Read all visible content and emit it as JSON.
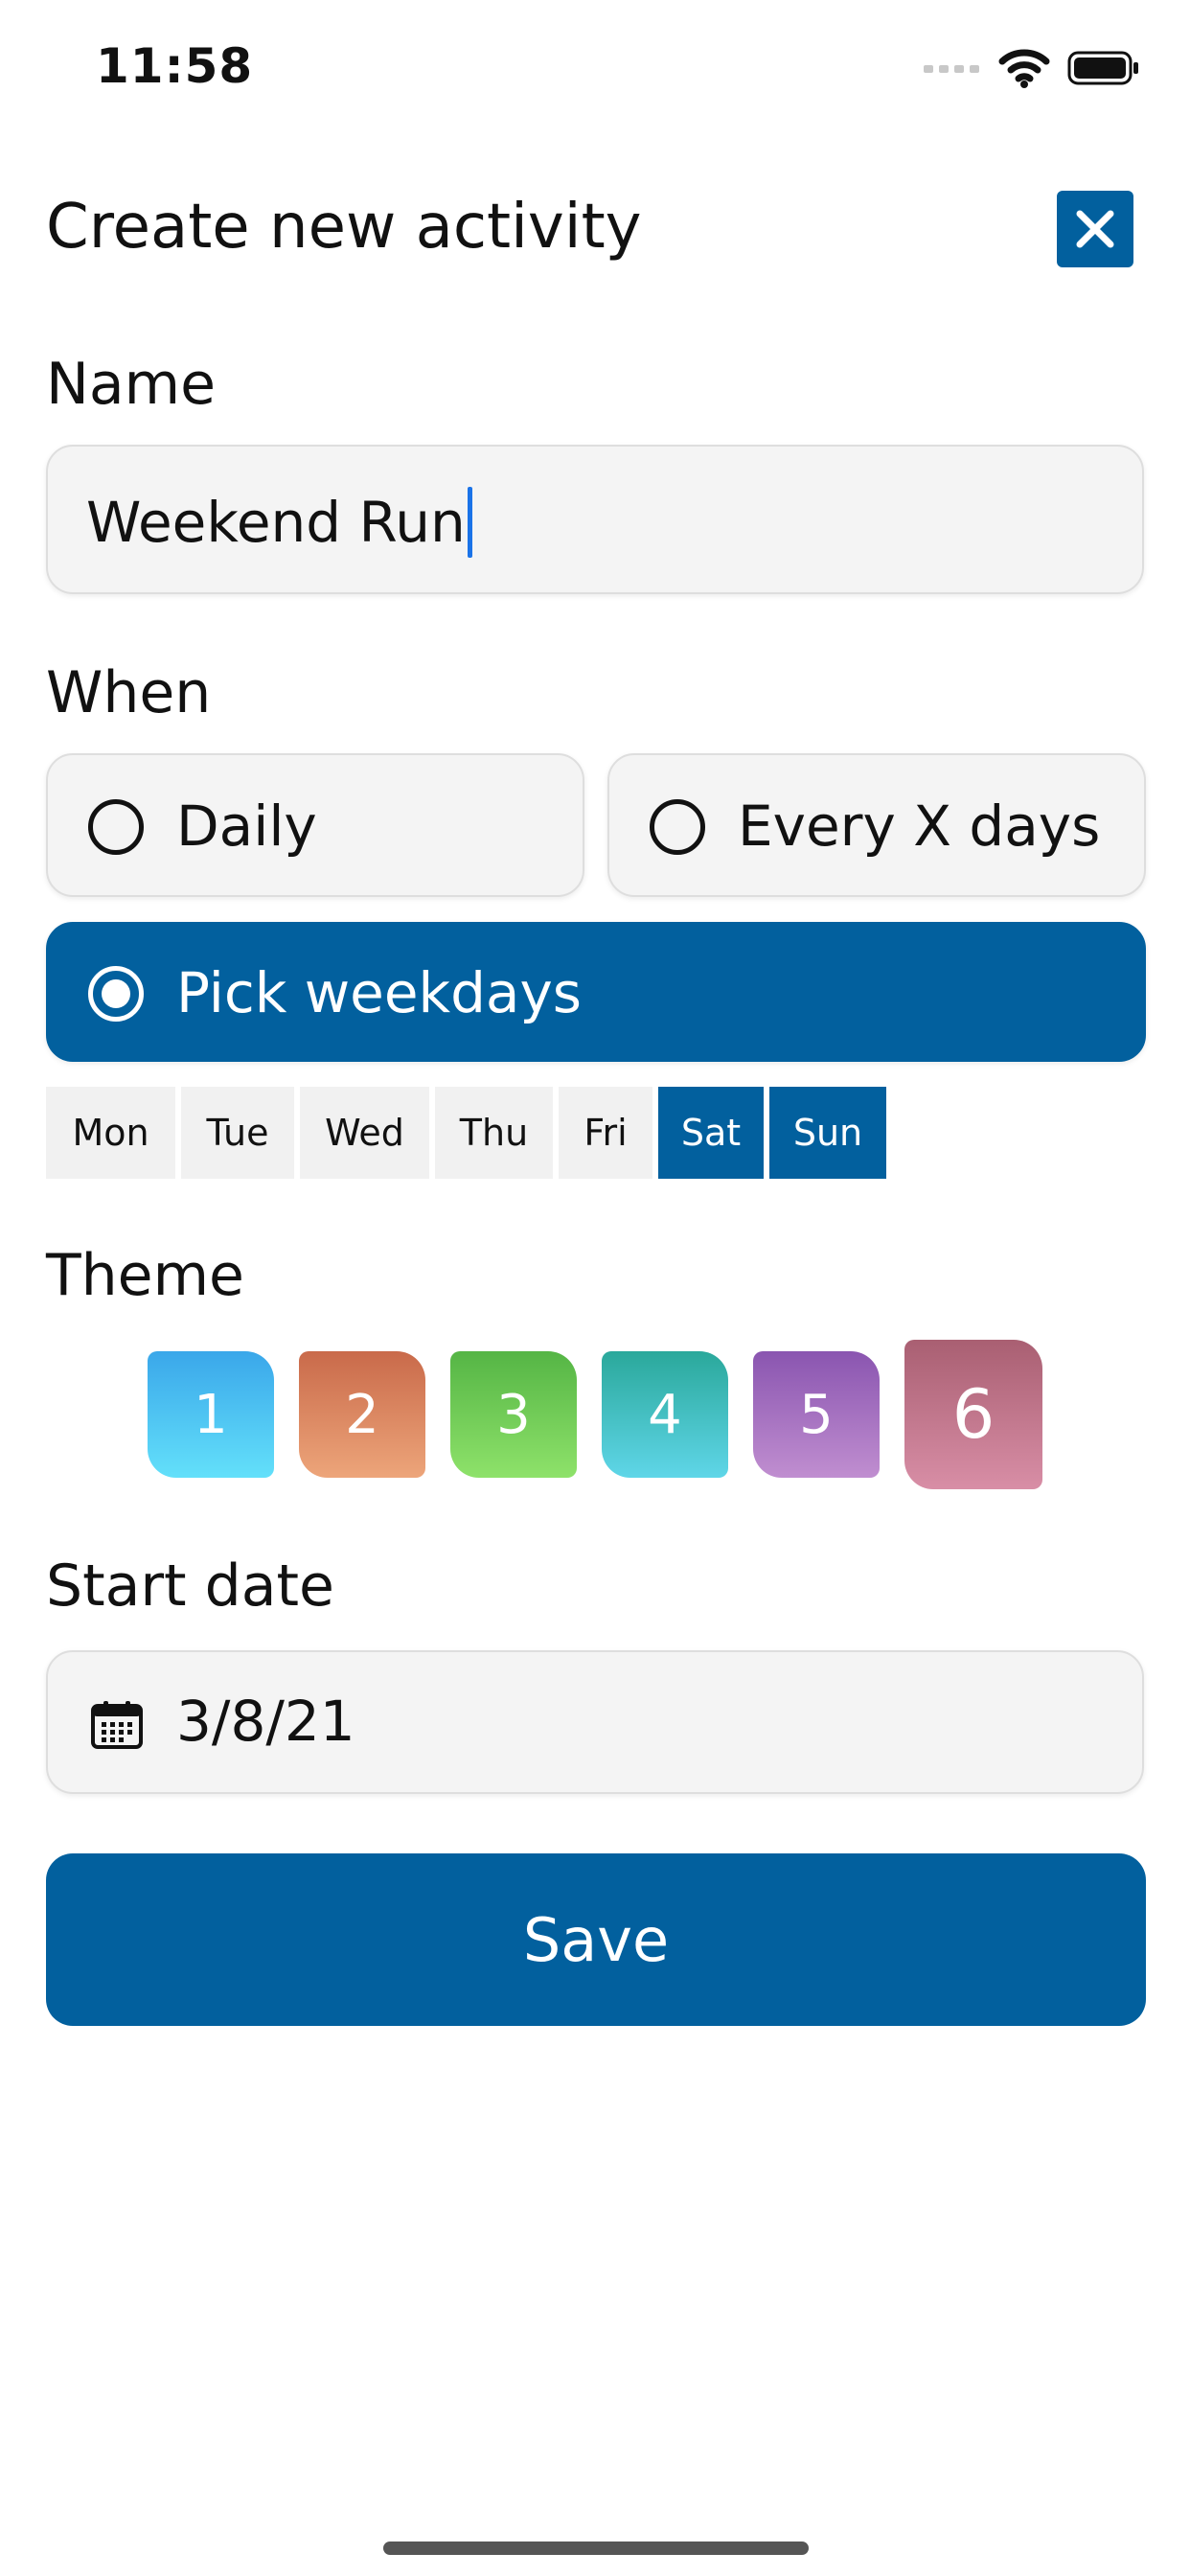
{
  "status_bar": {
    "time": "11:58"
  },
  "header": {
    "title": "Create new activity",
    "close_icon": "close-icon"
  },
  "name_section": {
    "label": "Name",
    "value": "Weekend Run"
  },
  "when_section": {
    "label": "When",
    "options": [
      {
        "label": "Daily",
        "selected": false
      },
      {
        "label": "Every X days",
        "selected": false
      },
      {
        "label": "Pick weekdays",
        "selected": true
      }
    ],
    "weekdays": [
      {
        "label": "Mon",
        "selected": false
      },
      {
        "label": "Tue",
        "selected": false
      },
      {
        "label": "Wed",
        "selected": false
      },
      {
        "label": "Thu",
        "selected": false
      },
      {
        "label": "Fri",
        "selected": false
      },
      {
        "label": "Sat",
        "selected": true
      },
      {
        "label": "Sun",
        "selected": true
      }
    ]
  },
  "theme_section": {
    "label": "Theme",
    "themes": [
      {
        "label": "1",
        "colors": [
          "#3aa7ea",
          "#63e0fa"
        ],
        "selected": false
      },
      {
        "label": "2",
        "colors": [
          "#c96a4a",
          "#eda57a"
        ],
        "selected": false
      },
      {
        "label": "3",
        "colors": [
          "#55b545",
          "#8ee26a"
        ],
        "selected": false
      },
      {
        "label": "4",
        "colors": [
          "#2aa89b",
          "#5fd6e8"
        ],
        "selected": false
      },
      {
        "label": "5",
        "colors": [
          "#8a55b0",
          "#c08ed0"
        ],
        "selected": false
      },
      {
        "label": "6",
        "colors": [
          "#a95f72",
          "#d88ea6"
        ],
        "selected": true
      }
    ]
  },
  "start_date_section": {
    "label": "Start date",
    "value": "3/8/21",
    "icon": "calendar-icon"
  },
  "actions": {
    "save_label": "Save"
  },
  "colors": {
    "accent": "#02609e",
    "field_background": "#f4f4f4"
  }
}
